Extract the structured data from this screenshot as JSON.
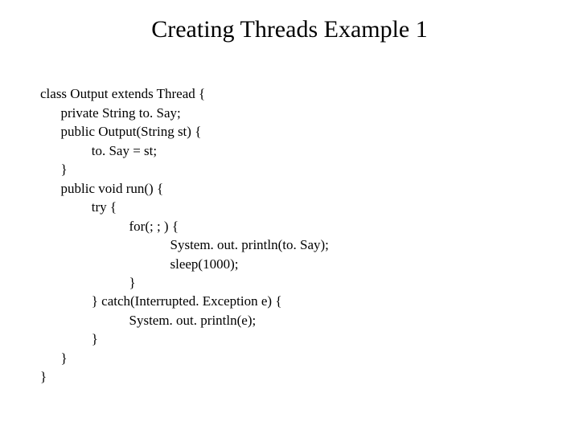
{
  "title": "Creating Threads Example 1",
  "code": {
    "l01": "class Output extends Thread {",
    "l02": "      private String to. Say;",
    "l03": "      public Output(String st) {",
    "l04": "               to. Say = st;",
    "l05": "      }",
    "l06": "      public void run() {",
    "l07": "               try {",
    "l08": "                          for(; ; ) {",
    "l09": "                                      System. out. println(to. Say);",
    "l10": "                                      sleep(1000);",
    "l11": "                          }",
    "l12": "               } catch(Interrupted. Exception e) {",
    "l13": "                          System. out. println(e);",
    "l14": "               }",
    "l15": "      }",
    "l16": "}"
  }
}
